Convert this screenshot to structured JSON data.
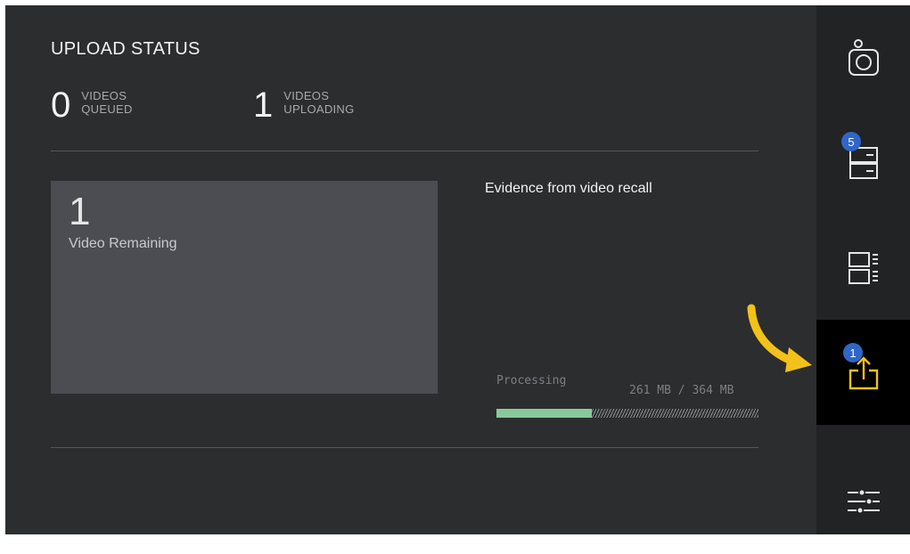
{
  "upload_status": {
    "title": "UPLOAD STATUS",
    "queued": {
      "count": "0",
      "label_line1": "VIDEOS",
      "label_line2": "QUEUED"
    },
    "uploading": {
      "count": "1",
      "label_line1": "VIDEOS",
      "label_line2": "UPLOADING"
    }
  },
  "card": {
    "count": "1",
    "label": "Video Remaining"
  },
  "item": {
    "title": "Evidence from video recall",
    "status": "Processing",
    "size_text": "261 MB / 364 MB",
    "progress_fraction": 0.365
  },
  "sidebar": {
    "items": [
      {
        "icon": "camera-icon"
      },
      {
        "icon": "storage-icon",
        "badge": "5"
      },
      {
        "icon": "list-icon"
      },
      {
        "icon": "upload-icon",
        "badge": "1",
        "active": true
      },
      {
        "icon": "settings-sliders-icon"
      }
    ]
  },
  "colors": {
    "accent_yellow": "#f3c21a",
    "badge_blue": "#2f66c8",
    "progress_green": "#88c999"
  }
}
